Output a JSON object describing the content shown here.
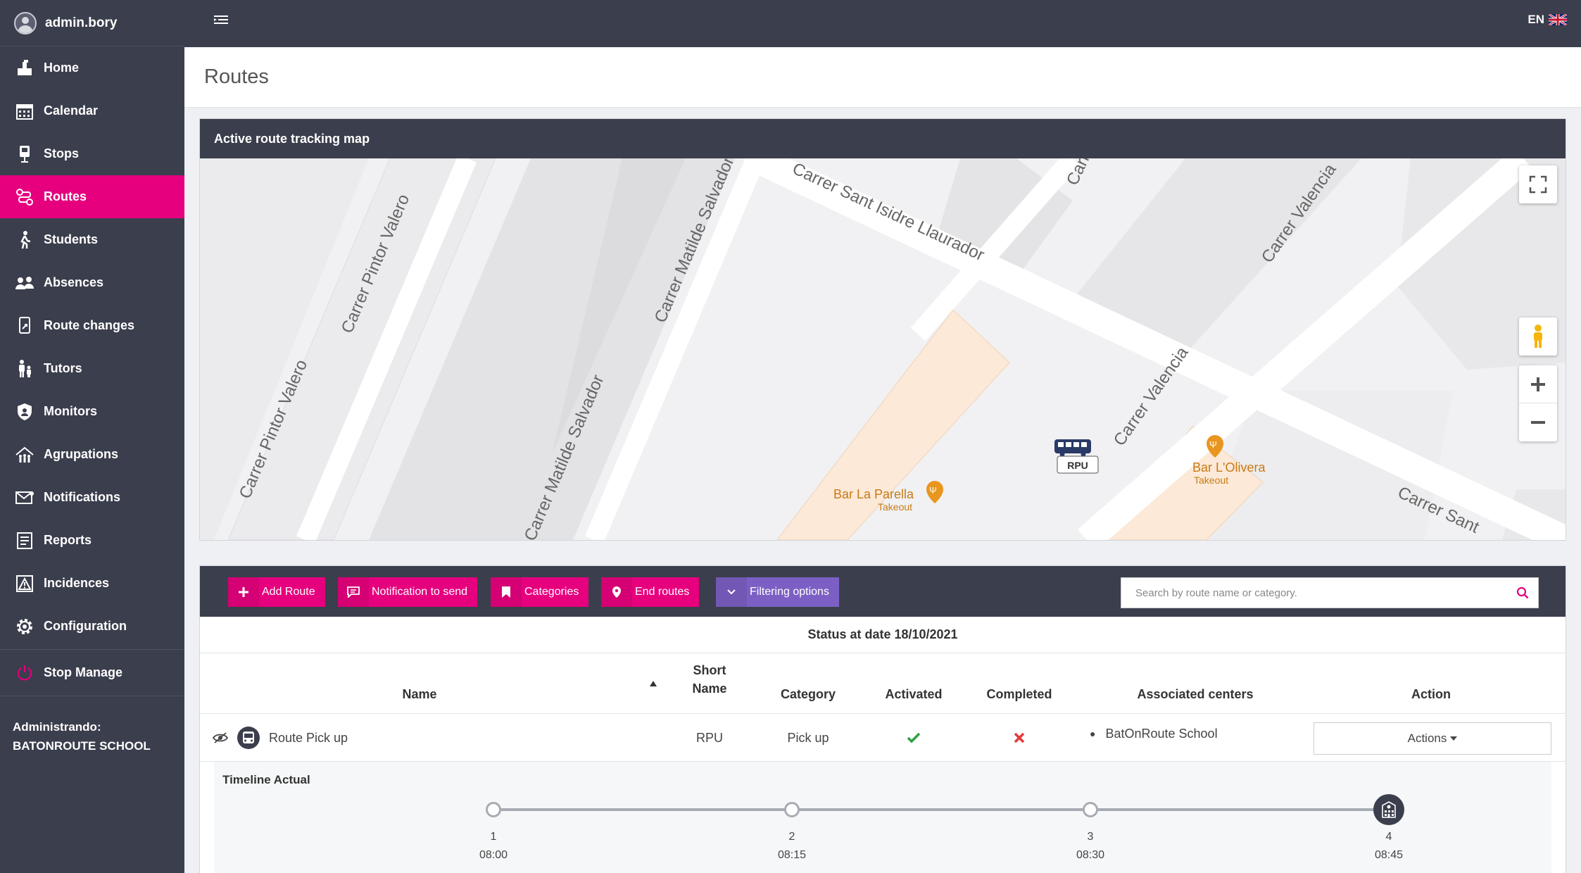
{
  "user": {
    "name": "admin.bory"
  },
  "sidebar": {
    "items": [
      {
        "label": "Home",
        "icon": "home-icon"
      },
      {
        "label": "Calendar",
        "icon": "calendar-icon"
      },
      {
        "label": "Stops",
        "icon": "bus-stop-icon"
      },
      {
        "label": "Routes",
        "icon": "route-icon",
        "active": true
      },
      {
        "label": "Students",
        "icon": "student-icon"
      },
      {
        "label": "Absences",
        "icon": "users-icon"
      },
      {
        "label": "Route changes",
        "icon": "route-change-icon"
      },
      {
        "label": "Tutors",
        "icon": "tutor-icon"
      },
      {
        "label": "Monitors",
        "icon": "shield-icon"
      },
      {
        "label": "Agrupations",
        "icon": "group-icon"
      },
      {
        "label": "Notifications",
        "icon": "envelope-icon"
      },
      {
        "label": "Reports",
        "icon": "report-icon"
      },
      {
        "label": "Incidences",
        "icon": "warning-icon"
      },
      {
        "label": "Configuration",
        "icon": "gear-icon"
      }
    ],
    "stop_manage": "Stop Manage",
    "admin_line1": "Administrando:",
    "admin_line2": "BATONROUTE SCHOOL"
  },
  "topbar": {
    "language": "EN"
  },
  "page": {
    "title": "Routes"
  },
  "map": {
    "title": "Active route tracking map",
    "streets": [
      "Carrer Sant Isidre Llaurador",
      "Carrer Pintor Valero",
      "Carrer Pintor Valero",
      "Carrer Matilde Salvador",
      "Carrer Matilde Salvador",
      "Carrer Valencia",
      "Carrer Valencia",
      "Carrer Sant",
      "Carr"
    ],
    "pois": [
      {
        "name": "Bar La Parella",
        "sub": "Takeout"
      },
      {
        "name": "Bar L'Olivera",
        "sub": "Takeout"
      }
    ],
    "bus_label": "RPU",
    "colors": {
      "accent": "#e6007e",
      "poi": "#e8961e",
      "building": "#fce9d8"
    }
  },
  "toolbar": {
    "add_route": "Add Route",
    "notification": "Notification to send",
    "categories": "Categories",
    "end_routes": "End routes",
    "filtering": "Filtering options",
    "search_placeholder": "Search by route name or category."
  },
  "table": {
    "status": "Status at date 18/10/2021",
    "headers": {
      "name": "Name",
      "short_name_1": "Short",
      "short_name_2": "Name",
      "category": "Category",
      "activated": "Activated",
      "completed": "Completed",
      "centers": "Associated centers",
      "action": "Action"
    },
    "rows": [
      {
        "name": "Route Pick up",
        "short_name": "RPU",
        "category": "Pick up",
        "activated": true,
        "completed": false,
        "center": "BatOnRoute School",
        "action_label": "Actions"
      }
    ]
  },
  "timeline": {
    "title": "Timeline Actual",
    "stops": [
      {
        "num": "1",
        "time": "08:00"
      },
      {
        "num": "2",
        "time": "08:15"
      },
      {
        "num": "3",
        "time": "08:30"
      },
      {
        "num": "4",
        "time": "08:45"
      }
    ]
  }
}
